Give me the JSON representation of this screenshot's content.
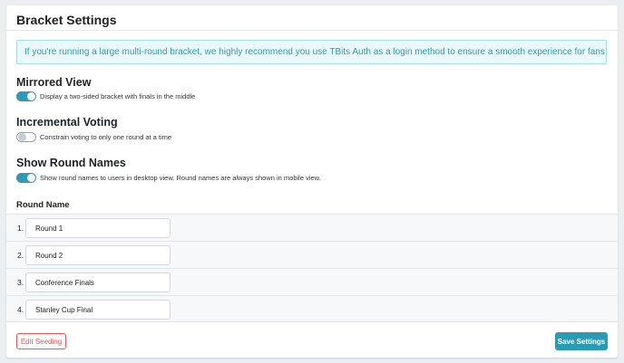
{
  "header": {
    "title": "Bracket Settings"
  },
  "notice": {
    "text": "If you're running a large multi-round bracket, we highly recommend you use TBits Auth as a login method to ensure a smooth experience for fans returning round over round."
  },
  "settings": [
    {
      "title": "Mirrored View",
      "description": "Display a two-sided bracket with finals in the middle",
      "enabled": true
    },
    {
      "title": "Incremental Voting",
      "description": "Constrain voting to only one round at a time",
      "enabled": false
    },
    {
      "title": "Show Round Names",
      "description": "Show round names to users in desktop view. Round names are always shown in mobile view.",
      "enabled": true
    }
  ],
  "rounds": {
    "header": "Round Name",
    "items": [
      {
        "number": "1.",
        "name": "Round 1"
      },
      {
        "number": "2.",
        "name": "Round 2"
      },
      {
        "number": "3.",
        "name": "Conference Finals"
      },
      {
        "number": "4.",
        "name": "Stanley Cup Final"
      }
    ]
  },
  "actions": {
    "edit_seeding": "Edit Seeding",
    "save": "Save Settings"
  },
  "colors": {
    "accent": "#2a9bb2",
    "toggle_on": "#2f99b8",
    "danger": "#e05a5a",
    "notice_bg": "#eafafc"
  }
}
